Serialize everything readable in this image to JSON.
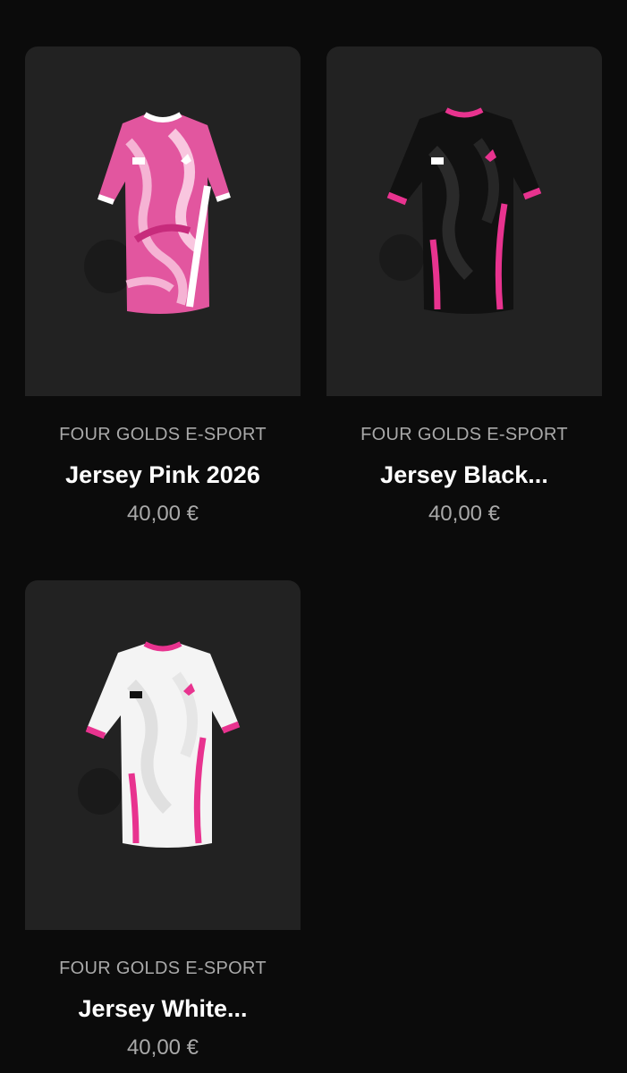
{
  "products": [
    {
      "brand": "FOUR GOLDS E-SPORT",
      "name": "Jersey Pink 2026",
      "price": "40,00 €",
      "variant": "pink"
    },
    {
      "brand": "FOUR GOLDS E-SPORT",
      "name": "Jersey Black...",
      "price": "40,00 €",
      "variant": "black"
    },
    {
      "brand": "FOUR GOLDS E-SPORT",
      "name": "Jersey White...",
      "price": "40,00 €",
      "variant": "white"
    }
  ],
  "colors": {
    "background": "#0b0b0b",
    "card": "#222222",
    "accent_pink": "#e8338f"
  }
}
